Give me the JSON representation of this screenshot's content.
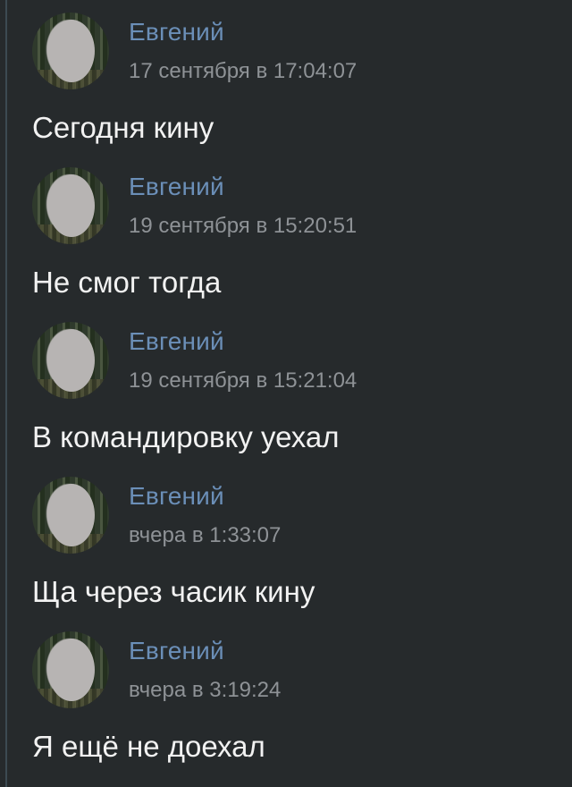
{
  "messages": [
    {
      "author": "Евгений",
      "timestamp": "17 сентября в 17:04:07",
      "text": "Сегодня кину"
    },
    {
      "author": "Евгений",
      "timestamp": "19 сентября в 15:20:51",
      "text": "Не смог тогда"
    },
    {
      "author": "Евгений",
      "timestamp": "19 сентября в 15:21:04",
      "text": "В командировку уехал"
    },
    {
      "author": "Евгений",
      "timestamp": "вчера в 1:33:07",
      "text": "Ща через часик кину"
    },
    {
      "author": "Евгений",
      "timestamp": "вчера в 3:19:24",
      "text": "Я ещё не доехал"
    }
  ],
  "colors": {
    "background": "#262a2c",
    "author": "#6b8fb8",
    "timestamp": "#8e9296",
    "text": "#f2f2f2"
  }
}
